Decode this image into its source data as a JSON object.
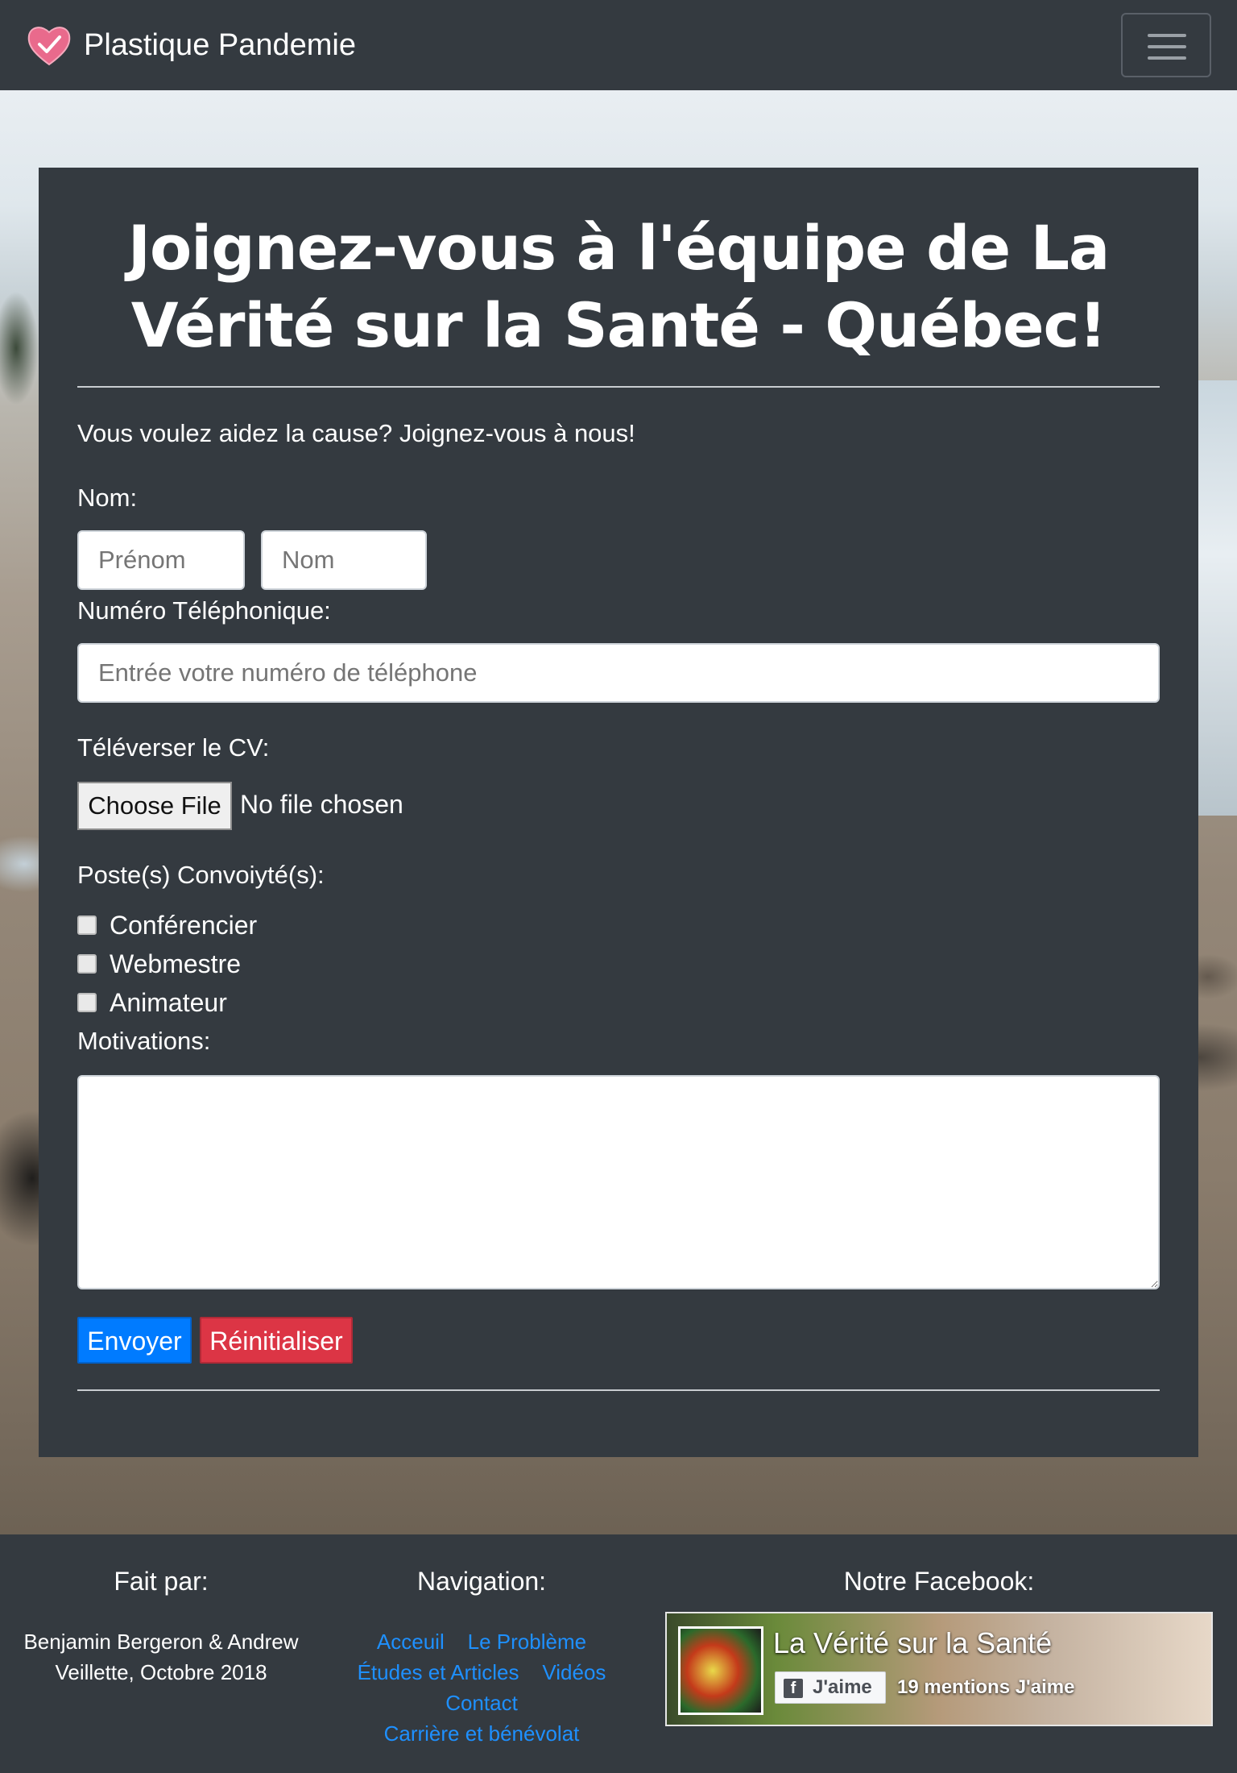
{
  "navbar": {
    "brand": "Plastique Pandemie",
    "icon": "heart-check-icon",
    "toggler_icon": "hamburger-menu-icon"
  },
  "form": {
    "title": "Joignez-vous à l'équipe de La Vérité sur la Santé - Québec!",
    "intro": "Vous voulez aidez la cause? Joignez-vous à nous!",
    "name_label": "Nom:",
    "first_name_placeholder": "Prénom",
    "last_name_placeholder": "Nom",
    "phone_label": "Numéro Téléphonique:",
    "phone_placeholder": "Entrée votre numéro de téléphone",
    "cv_label": "Téléverser le CV:",
    "file_button": "Choose File",
    "file_status": "No file chosen",
    "positions_label": "Poste(s) Convoiyté(s):",
    "positions": [
      {
        "label": "Conférencier",
        "checked": false
      },
      {
        "label": "Webmestre",
        "checked": false
      },
      {
        "label": "Animateur",
        "checked": false
      }
    ],
    "motivations_label": "Motivations:",
    "motivations_value": "",
    "submit_label": "Envoyer",
    "reset_label": "Réinitialiser"
  },
  "footer": {
    "credits_heading": "Fait par:",
    "credits_line1": "Benjamin Bergeron & Andrew",
    "credits_line2": "Veillette, Octobre 2018",
    "nav_heading": "Navigation:",
    "nav_links": [
      "Acceuil",
      "Le Problème",
      "Études et Articles",
      "Vidéos",
      "Contact",
      "Carrière et bénévolat"
    ],
    "facebook_heading": "Notre Facebook:",
    "facebook_page_name": "La Vérité sur la Santé",
    "facebook_like_label": "J'aime",
    "facebook_like_count": "19 mentions J'aime"
  },
  "colors": {
    "dark": "#343a40",
    "primary": "#007bff",
    "danger": "#dc3545",
    "link": "#1e90ff",
    "brand_heart": "#e96a8c"
  }
}
